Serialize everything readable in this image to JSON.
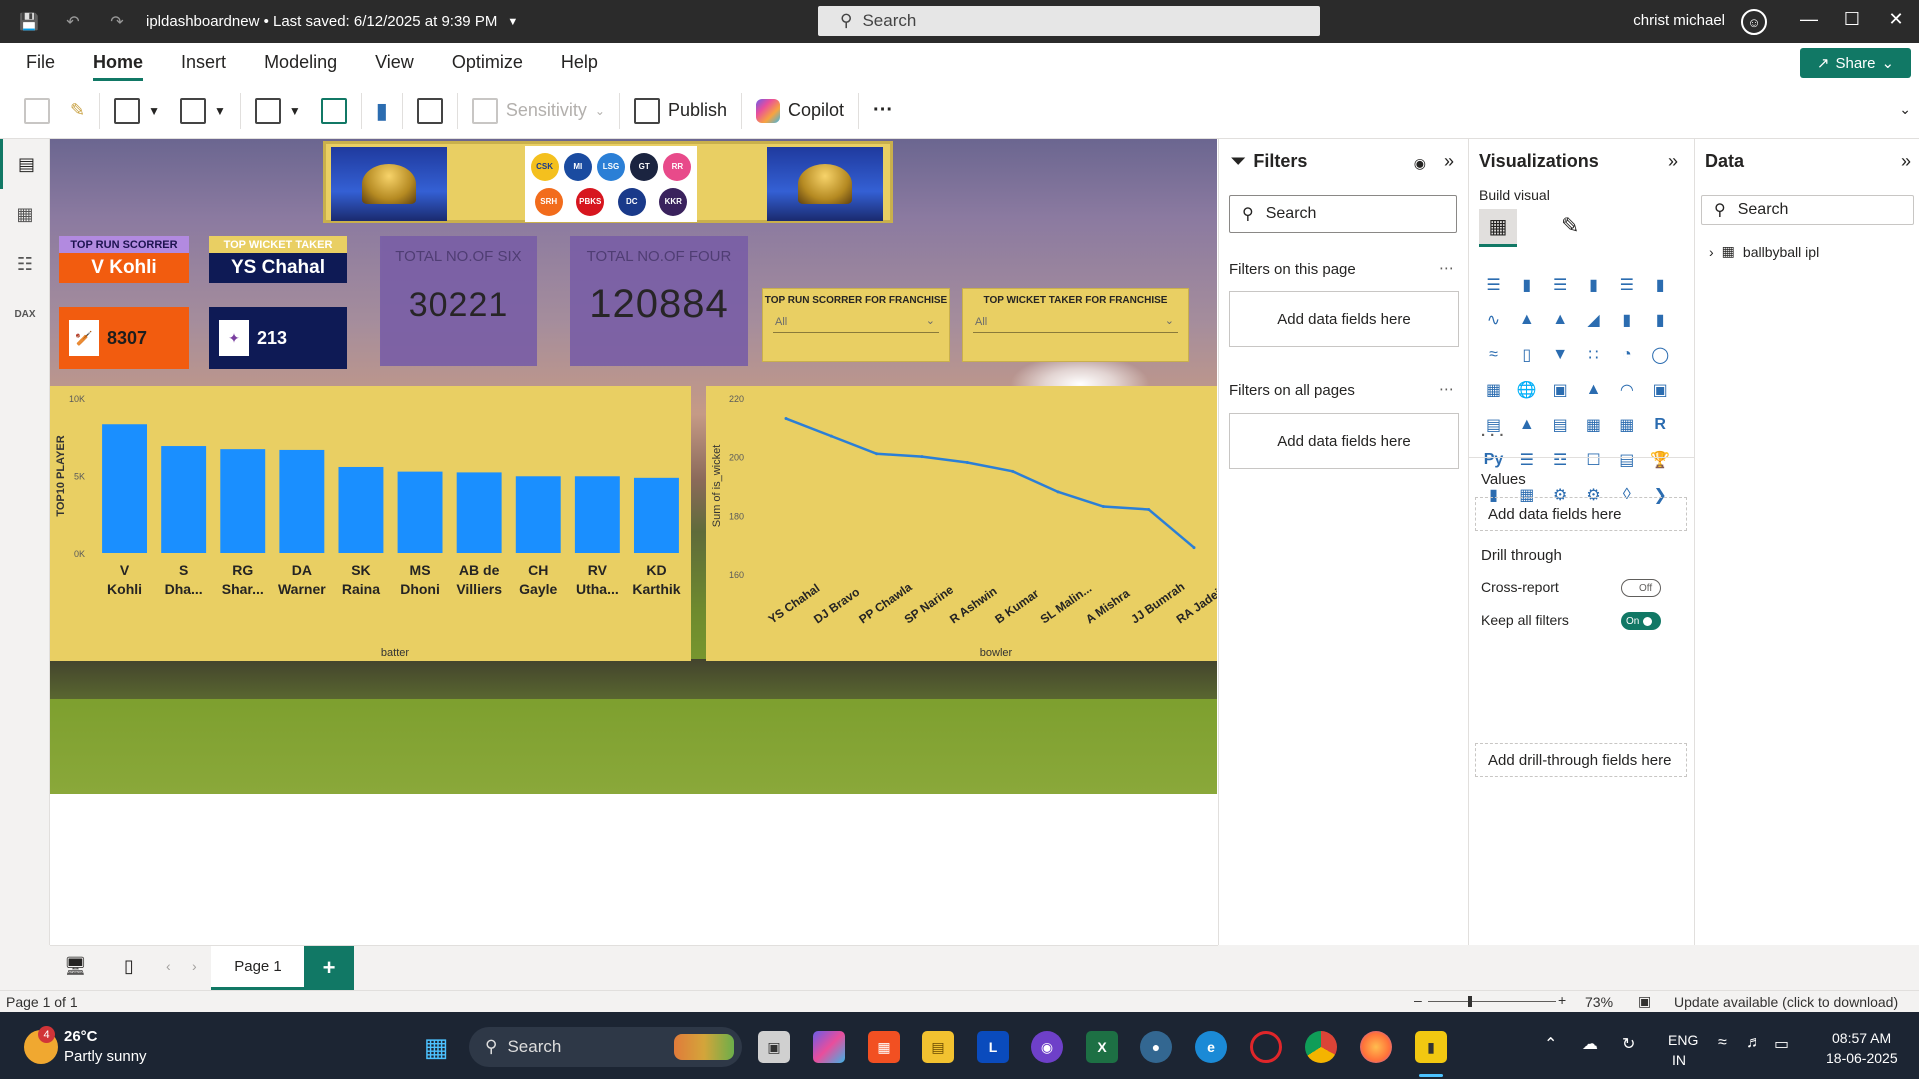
{
  "titlebar": {
    "doc_title": "ipldashboardnew • Last saved: 6/12/2025 at 9:39 PM",
    "search_placeholder": "Search",
    "user_name": "christ michael"
  },
  "menu": [
    "File",
    "Home",
    "Insert",
    "Modeling",
    "View",
    "Optimize",
    "Help"
  ],
  "share_label": "Share",
  "ribbon": {
    "sensitivity": "Sensitivity",
    "publish": "Publish",
    "copilot": "Copilot",
    "more": "···"
  },
  "report": {
    "top_run_label": "TOP RUN SCORRER",
    "top_run_name": "V Kohli",
    "top_run_value": "8307",
    "top_wicket_label": "TOP WICKET TAKER",
    "top_wicket_name": "YS Chahal",
    "top_wicket_value": "213",
    "six_label": "TOTAL NO.OF SIX",
    "six_value": "30221",
    "four_label": "TOTAL NO.OF FOUR",
    "four_value": "120884",
    "slicer1_title": "TOP RUN SCORRER FOR FRANCHISE",
    "slicer1_value": "All",
    "slicer2_title": "TOP WICKET TAKER FOR FRANCHISE",
    "slicer2_value": "All"
  },
  "chart_data": [
    {
      "type": "bar",
      "categories": [
        "V Kohli",
        "S Dha...",
        "RG Shar...",
        "DA Warner",
        "SK Raina",
        "MS Dhoni",
        "AB de Villiers",
        "CH Gayle",
        "RV Utha...",
        "KD Karthik"
      ],
      "values": [
        8307,
        6900,
        6700,
        6650,
        5550,
        5250,
        5200,
        4950,
        4950,
        4850
      ],
      "ylabel": "TOP10 PLAYER",
      "xlabel": "batter",
      "ylim": [
        0,
        10000
      ],
      "yticks": [
        "0K",
        "5K",
        "10K"
      ],
      "bar_color": "#1a8fff"
    },
    {
      "type": "line",
      "categories": [
        "YS Chahal",
        "DJ Bravo",
        "PP Chawla",
        "SP Narine",
        "R Ashwin",
        "B Kumar",
        "SL Malin...",
        "A Mishra",
        "JJ Bumrah",
        "RA Jadeja"
      ],
      "values": [
        213,
        207,
        201,
        200,
        198,
        195,
        188,
        183,
        182,
        169
      ],
      "ylabel": "Sum of is_wicket",
      "xlabel": "bowler",
      "ylim": [
        160,
        220
      ],
      "yticks": [
        "160",
        "180",
        "200",
        "220"
      ],
      "line_color": "#2b7fd6"
    }
  ],
  "filters": {
    "title": "Filters",
    "search": "Search",
    "this_page": "Filters on this page",
    "all_pages": "Filters on all pages",
    "add_fields": "Add data fields here"
  },
  "visualizations": {
    "title": "Visualizations",
    "build": "Build visual",
    "values": "Values",
    "add_fields": "Add data fields here",
    "drill": "Drill through",
    "cross": "Cross-report",
    "cross_state": "Off",
    "keep": "Keep all filters",
    "keep_state": "On",
    "add_drill": "Add drill-through fields here",
    "more": "· · ·"
  },
  "data_pane": {
    "title": "Data",
    "search": "Search",
    "table": "ballbyball ipl"
  },
  "pages": {
    "tab": "Page 1",
    "add": "+"
  },
  "status": {
    "page": "Page 1 of 1",
    "zoom": "73%",
    "update": "Update available (click to download)"
  },
  "taskbar": {
    "weather_temp": "26°C",
    "weather_desc": "Partly sunny",
    "weather_badge": "4",
    "search": "Search",
    "lang1": "ENG",
    "lang2": "IN",
    "time": "08:57 AM",
    "date": "18-06-2025"
  }
}
